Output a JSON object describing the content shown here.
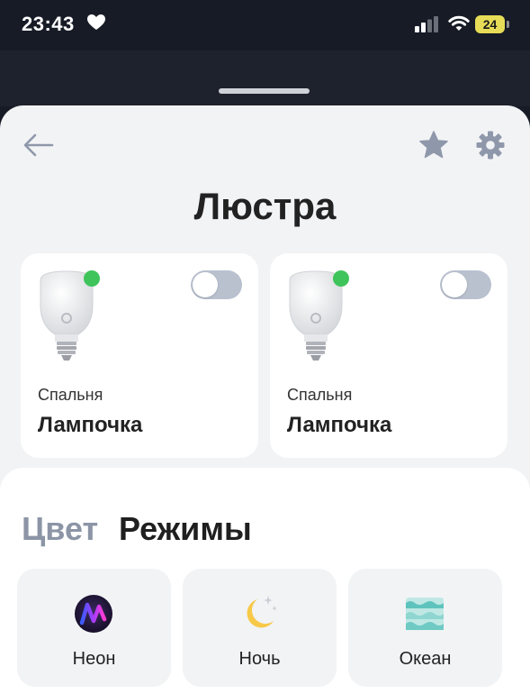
{
  "status_bar": {
    "time": "23:43",
    "battery": "24"
  },
  "header": {
    "title": "Люстра"
  },
  "devices": [
    {
      "room": "Спальня",
      "name": "Лампочка",
      "online": true,
      "on": false
    },
    {
      "room": "Спальня",
      "name": "Лампочка",
      "online": true,
      "on": false
    }
  ],
  "tabs": [
    {
      "label": "Цвет",
      "active": false
    },
    {
      "label": "Режимы",
      "active": true
    }
  ],
  "modes": [
    {
      "label": "Неон",
      "icon": "neon-icon"
    },
    {
      "label": "Ночь",
      "icon": "moon-stars-icon"
    },
    {
      "label": "Океан",
      "icon": "waves-icon"
    }
  ],
  "colors": {
    "accent_online": "#3fc45b",
    "toggle_off": "#b9c1cf",
    "battery": "#e7dc57"
  }
}
